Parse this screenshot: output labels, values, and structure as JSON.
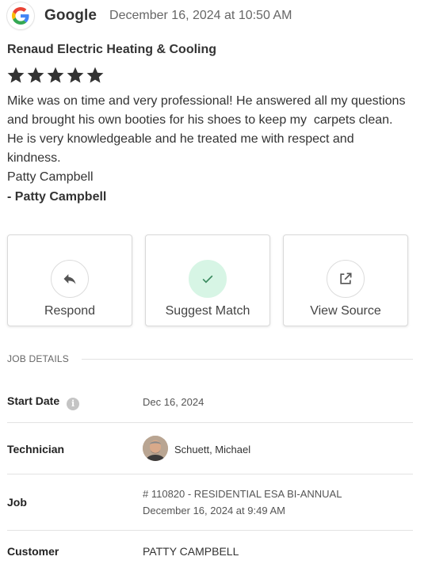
{
  "review": {
    "source": "Google",
    "date": "December 16, 2024 at 10:50 AM",
    "business": "Renaud Electric Heating & Cooling",
    "rating": 5,
    "lines": [
      "Mike was on time and very professional! He answered all my questions",
      "and brought his own booties for his shoes to keep my  carpets clean.",
      "He is very knowledgeable and he treated me with respect and",
      "kindness.",
      "Patty Campbell"
    ],
    "signoff": "- Patty Campbell"
  },
  "actions": {
    "respond": "Respond",
    "suggest": "Suggest Match",
    "view": "View Source"
  },
  "job": {
    "section_title": "JOB DETAILS",
    "start_date_label": "Start Date",
    "start_date": "Dec 16, 2024",
    "technician_label": "Technician",
    "technician": "Schuett, Michael",
    "job_label": "Job",
    "job_link": "# 110820 - RESIDENTIAL ESA BI-ANNUAL",
    "job_date": "December 16, 2024 at 9:49 AM",
    "customer_label": "Customer",
    "customer": "PATTY CAMPBELL"
  },
  "icons": {
    "source_logo": "google-g-icon",
    "info": "info-icon",
    "respond": "reply-arrow-icon",
    "suggest": "checkmark-icon",
    "view": "external-link-icon",
    "star": "star-icon"
  },
  "colors": {
    "link": "#2a7ac7",
    "suggest_bg": "#d7f5e5",
    "star": "#333333"
  }
}
